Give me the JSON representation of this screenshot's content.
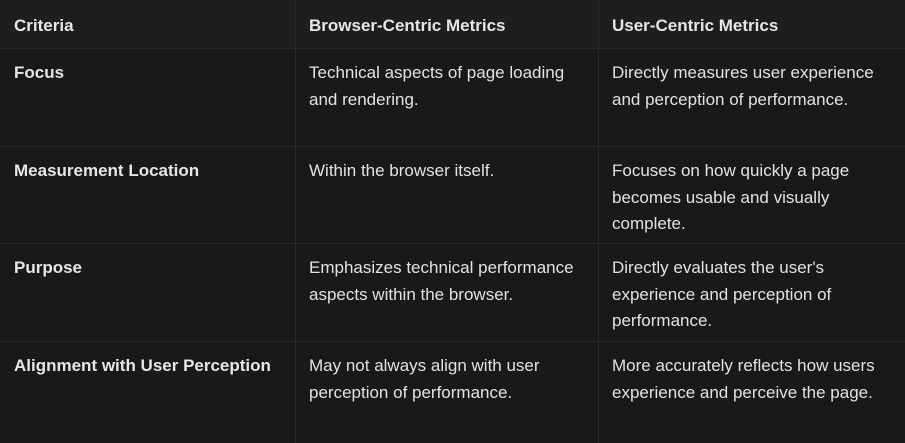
{
  "table": {
    "headers": [
      "Criteria",
      "Browser-Centric Metrics",
      "User-Centric Metrics"
    ],
    "rows": [
      {
        "criteria": "Focus",
        "browser": "Technical aspects of page loading and rendering.",
        "user": "Directly measures user experience and perception of performance."
      },
      {
        "criteria": "Measurement Location",
        "browser": "Within the browser itself.",
        "user": "Focuses on how quickly a page becomes usable and visually complete."
      },
      {
        "criteria": "Purpose",
        "browser": "Emphasizes technical performance aspects within the browser.",
        "user": "Directly evaluates the user's experience and perception of performance."
      },
      {
        "criteria": "Alignment with User Perception",
        "browser": "May not always align with user perception of performance.",
        "user": "More accurately reflects how users experience and perceive the page."
      }
    ]
  }
}
